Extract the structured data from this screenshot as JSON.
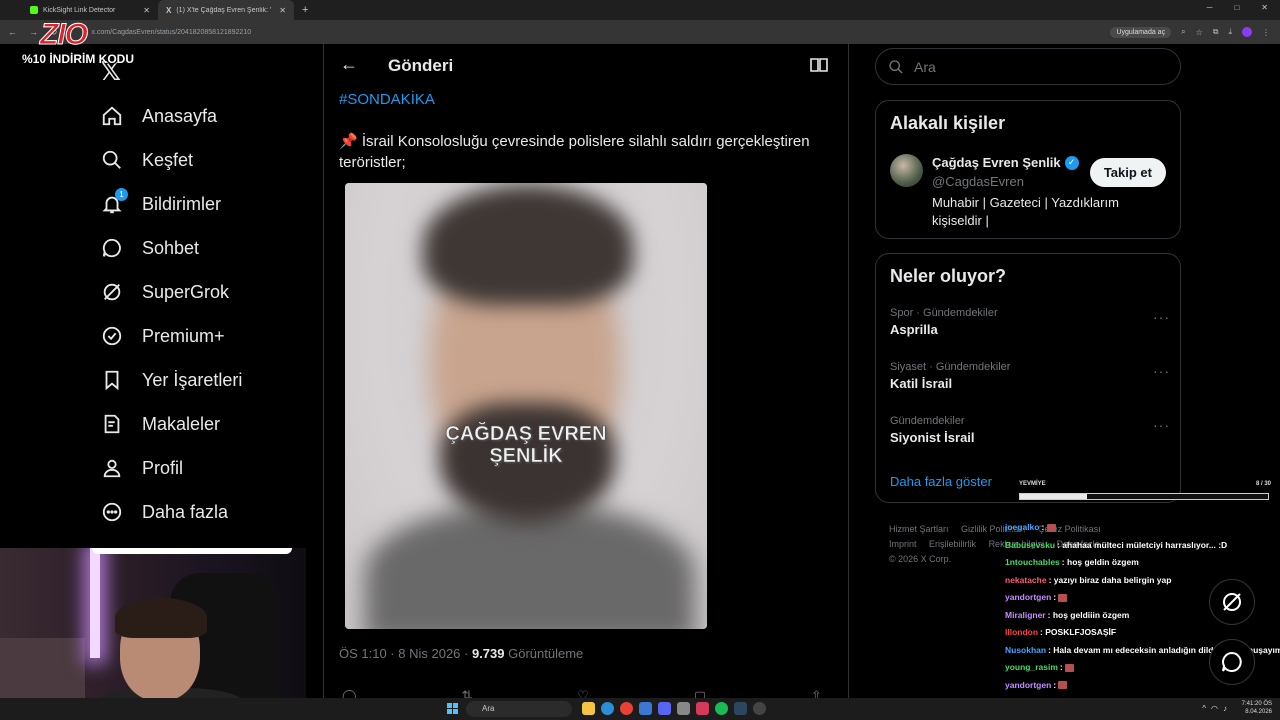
{
  "browser": {
    "tabs": [
      {
        "title": "KickSight Link Detector",
        "favicon_color": "#53fc18"
      },
      {
        "title": "(1) X'te Çağdaş Evren Şenlik: \"#",
        "favicon_color": "#ffffff"
      }
    ],
    "new_tab": "+",
    "url": "x.com/CagdasEvren/status/2041820858121892210",
    "app_button": "Uygulamada aç",
    "win_controls": [
      "─",
      "□",
      "✕"
    ]
  },
  "promo": {
    "logo": "ZIO",
    "text": "%10 İNDİRİM KODU"
  },
  "nav": {
    "items": [
      {
        "label": "Anasayfa",
        "icon": "home-icon"
      },
      {
        "label": "Keşfet",
        "icon": "search-icon"
      },
      {
        "label": "Bildirimler",
        "icon": "bell-icon",
        "badge": "1"
      },
      {
        "label": "Sohbet",
        "icon": "chat-icon"
      },
      {
        "label": "SuperGrok",
        "icon": "grok-icon"
      },
      {
        "label": "Premium+",
        "icon": "verified-icon"
      },
      {
        "label": "Yer İşaretleri",
        "icon": "bookmark-icon"
      },
      {
        "label": "Makaleler",
        "icon": "article-icon"
      },
      {
        "label": "Profil",
        "icon": "person-icon"
      },
      {
        "label": "Daha fazla",
        "icon": "more-icon"
      }
    ]
  },
  "post": {
    "header_title": "Gönderi",
    "hashtag": "#SONDAKİKA",
    "pin_emoji": "📌",
    "text": "İsrail Konsolosluğu çevresinde polislere silahlı saldırı gerçekleştiren teröristler;",
    "image_watermark_line1": "ÇAĞDAŞ EVREN",
    "image_watermark_line2": "ŞENLİK",
    "time": "ÖS 1:10 · 8 Nis 2026 ·",
    "views": "9.739",
    "views_label": "Görüntüleme"
  },
  "search": {
    "placeholder": "Ara"
  },
  "related": {
    "title": "Alakalı kişiler",
    "name": "Çağdaş Evren Şenlik",
    "handle": "@CagdasEvren",
    "follow": "Takip et",
    "bio": "Muhabir | Gazeteci | Yazdıklarım kişiseldir |"
  },
  "trends": {
    "title": "Neler oluyor?",
    "items": [
      {
        "category": "Spor · Gündemdekiler",
        "name": "Asprilla"
      },
      {
        "category": "Siyaset · Gündemdekiler",
        "name": "Katil İsrail"
      },
      {
        "category": "Gündemdekiler",
        "name": "Siyonist İsrail"
      }
    ],
    "show_more": "Daha fazla göster"
  },
  "footer": {
    "links": [
      "Hizmet Şartları",
      "Gizlilik Politikası",
      "Çerez Politikası",
      "Imprint",
      "Erişilebilirlik",
      "Reklam bilgisi",
      "Daha fazla ···"
    ],
    "copyright": "© 2026 X Corp."
  },
  "progress": {
    "label": "YEVMİYE",
    "count": "8 / 30",
    "fraction": 0.27
  },
  "chat": [
    {
      "user": "joegalko",
      "color": "#4aa3ff",
      "msg": ""
    },
    {
      "user": "Babusevsku",
      "color": "#4cd964",
      "msg": "ahahaa mülteci mületciyi harraslıyor... :D"
    },
    {
      "user": "1ntouchables",
      "color": "#4cd964",
      "msg": "hoş geldin özgem"
    },
    {
      "user": "nekatache",
      "color": "#ff5a7a",
      "msg": "yazıyı biraz daha belirgin yap"
    },
    {
      "user": "yandortgen",
      "color": "#c58cff",
      "msg": ""
    },
    {
      "user": "Miraligner",
      "color": "#c58cff",
      "msg": "hoş geldiiin özgem"
    },
    {
      "user": "lllondon",
      "color": "#ff4040",
      "msg": "POSKLFJOSAŞİF"
    },
    {
      "user": "Nusokhan",
      "color": "#4aa3ff",
      "msg": "Hala devam mı edeceksin anladığın dilden mi konuşayım"
    },
    {
      "user": "young_rasim",
      "color": "#4cd964",
      "msg": ""
    },
    {
      "user": "yandortgen",
      "color": "#c58cff",
      "msg": ""
    },
    {
      "user": "Akinau",
      "color": "#4aa3ff",
      "msg": ""
    }
  ],
  "taskbar": {
    "search": "Ara",
    "time": "7:41:20 ÖS",
    "date": "8.04.2026"
  }
}
